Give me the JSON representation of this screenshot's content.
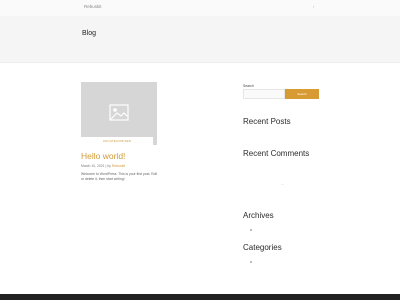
{
  "header": {
    "site_name": "Rebuskit",
    "menu_icon": "menu-toggle-icon"
  },
  "page_header": {
    "title": "Blog"
  },
  "post": {
    "thumbnail_icon": "image-placeholder-icon",
    "category": "UNCATEGORIZED",
    "title": "Hello world!",
    "date": "March 10, 2021",
    "separator": "|",
    "by": "by",
    "author": "Rebuskit",
    "excerpt": "Welcome to WordPress. This is your first post. Edit or delete it, then start writing!"
  },
  "sidebar": {
    "search": {
      "label": "Search",
      "placeholder": "",
      "button": "Search"
    },
    "recent_posts": "Recent Posts",
    "recent_comments": "Recent Comments",
    "comment_item": "...",
    "archives": "Archives",
    "categories": "Categories"
  },
  "colors": {
    "accent": "#d19b3a",
    "button": "#d89b34",
    "header_bg": "#f5f5f5",
    "footer": "#222222"
  }
}
